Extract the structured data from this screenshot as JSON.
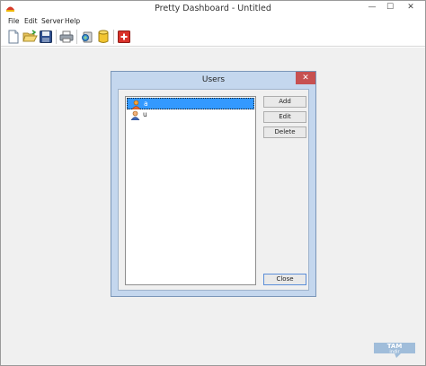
{
  "window": {
    "title": "Pretty Dashboard - Untitled",
    "min_glyph": "—",
    "max_glyph": "☐",
    "close_glyph": "✕"
  },
  "menu": [
    {
      "label": "File"
    },
    {
      "label": "Edit"
    },
    {
      "label": "Server"
    },
    {
      "label": "Help"
    }
  ],
  "toolbar": {
    "buttons": [
      {
        "icon": "new-document-icon"
      },
      {
        "icon": "open-folder-icon"
      },
      {
        "icon": "save-disk-icon"
      },
      {
        "icon": "print-icon"
      },
      {
        "icon": "server-connect-icon"
      },
      {
        "icon": "database-icon"
      },
      {
        "icon": "add-red-icon"
      }
    ]
  },
  "dialog": {
    "title": "Users",
    "close_glyph": "✕",
    "users": [
      {
        "label": "a",
        "selected": true,
        "icon": "user-admin-icon"
      },
      {
        "label": "u",
        "selected": false,
        "icon": "user-icon"
      }
    ],
    "buttons": {
      "add": "Add",
      "edit": "Edit",
      "delete": "Delete",
      "close": "Close"
    }
  },
  "watermark": {
    "line1": "TAM",
    "line2": "indir"
  },
  "colors": {
    "dialog_frame": "#c4d7ee",
    "selection": "#3399ff",
    "close_button": "#c75050"
  }
}
